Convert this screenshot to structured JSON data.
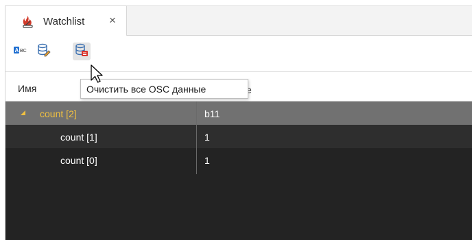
{
  "tab": {
    "label": "Watchlist",
    "close_glyph": "×",
    "icon": "watchlist-flame-icon"
  },
  "toolbar": {
    "buttons": [
      {
        "name": "abc-format-button",
        "icon": "abc-icon",
        "badge_text": "ABC"
      },
      {
        "name": "database-edit-button",
        "icon": "database-edit-icon"
      },
      {
        "name": "clear-osc-data-button",
        "icon": "database-clear-icon"
      }
    ],
    "tooltip": "Очистить все OSC данные"
  },
  "table": {
    "columns": [
      "Имя",
      "е"
    ],
    "rows": [
      {
        "name": "count [2]",
        "value": "b11",
        "expanded": true,
        "selected": true
      },
      {
        "name": "count [1]",
        "value": "1"
      },
      {
        "name": "count [0]",
        "value": "1"
      }
    ]
  },
  "colors": {
    "selected_row_bg": "#717171",
    "expanded_name_color": "#f0c040",
    "grid_bg": "#232323",
    "tooltip_bg": "#ffffff"
  }
}
